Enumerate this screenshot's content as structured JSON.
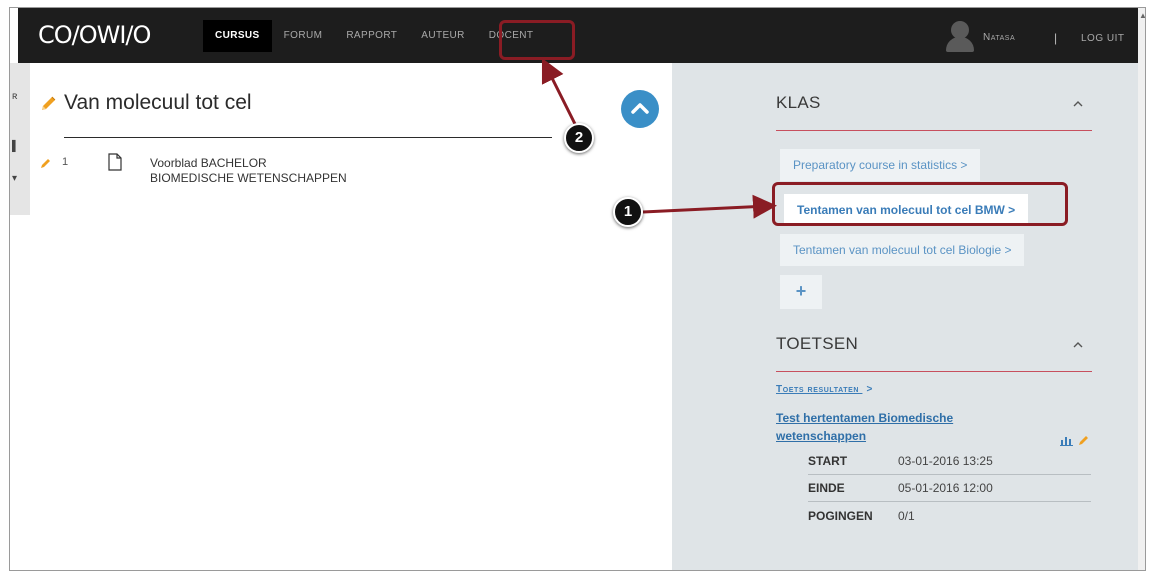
{
  "topbar": {
    "logo": "CO/OWI/O",
    "nav": [
      "CURSUS",
      "FORUM",
      "RAPPORT",
      "AUTEUR",
      "DOCENT"
    ],
    "active_nav": "CURSUS",
    "user_name": "Natasa",
    "separator": "|",
    "logout": "LOG UIT"
  },
  "main": {
    "course_title": "Van molecuul tot cel",
    "chapter": {
      "number": "1",
      "title_line1": "Voorblad BACHELOR",
      "title_line2": "BIOMEDISCHE WETENSCHAPPEN"
    }
  },
  "sidebar": {
    "klas": {
      "heading": "KLAS",
      "classes": [
        "Preparatory course in statistics >",
        "Tentamen van molecuul tot cel BMW >",
        "Tentamen van molecuul tot cel Biologie >"
      ],
      "add": "+"
    },
    "toetsen": {
      "heading": "TOETSEN",
      "results_link": "Toets resultaten",
      "results_chevron": ">",
      "test_title": "Test hertentamen Biomedische wetenschappen",
      "rows": [
        {
          "key": "START",
          "value": "03-01-2016 13:25"
        },
        {
          "key": "EINDE",
          "value": "05-01-2016 12:00"
        },
        {
          "key": "POGINGEN",
          "value": "0/1"
        }
      ]
    }
  },
  "annotations": {
    "badge1": "1",
    "badge2": "2"
  },
  "colors": {
    "topbar_bg": "#1d1d1d",
    "sidebar_bg": "#dfe4e7",
    "accent_blue": "#3a8fc7",
    "link_blue": "#3a7cb8",
    "section_rule": "#c74f5e",
    "pencil_orange": "#f0a020",
    "annotation_red": "#8a1c24"
  }
}
